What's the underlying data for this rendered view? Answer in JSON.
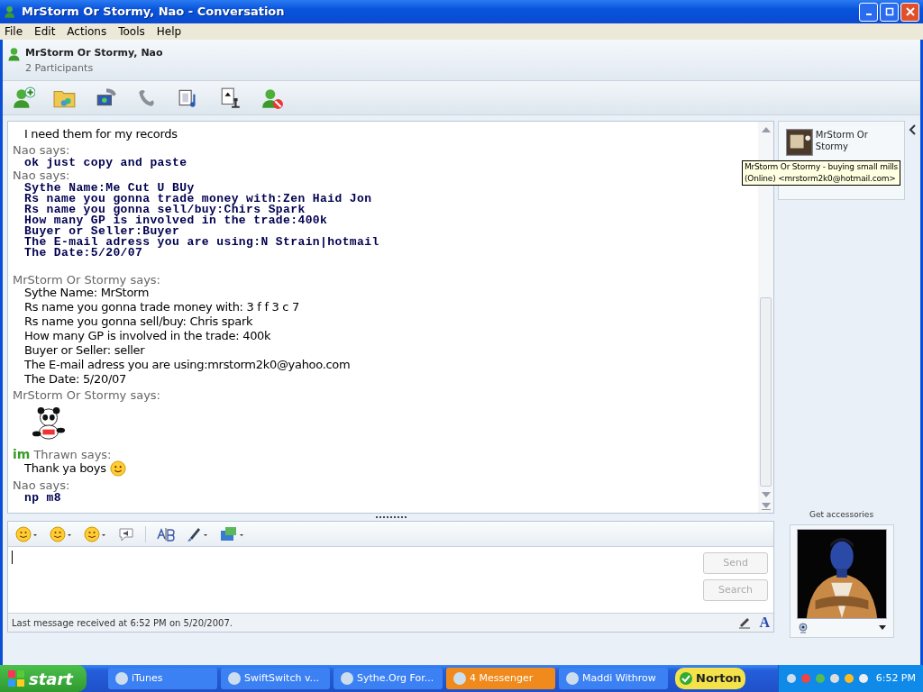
{
  "window": {
    "title": "MrStorm Or Stormy, Nao - Conversation"
  },
  "menu": [
    "File",
    "Edit",
    "Actions",
    "Tools",
    "Help"
  ],
  "header": {
    "title": "MrStorm Or Stormy, Nao",
    "subtitle": "2 Participants"
  },
  "messages": [
    {
      "kind": "plain",
      "text": "I need them for my records"
    },
    {
      "kind": "sender",
      "text": "Nao says:",
      "icon": false
    },
    {
      "kind": "mono",
      "text": "ok just copy and paste"
    },
    {
      "kind": "sender",
      "text": "Nao says:",
      "icon": false
    },
    {
      "kind": "mono",
      "text": "Sythe Name:Me Cut U BUy"
    },
    {
      "kind": "mono",
      "text": "Rs name you gonna trade money with:Zen Haid Jon"
    },
    {
      "kind": "mono",
      "text": "Rs name you gonna sell/buy:Chirs Spark"
    },
    {
      "kind": "mono",
      "text": "How many GP is involved in the trade:400k"
    },
    {
      "kind": "mono",
      "text": "Buyer or Seller:Buyer"
    },
    {
      "kind": "mono",
      "text": "The E-mail adress you are using:N Strain|hotmail"
    },
    {
      "kind": "mono",
      "text": "The Date:5/20/07"
    },
    {
      "kind": "gap"
    },
    {
      "kind": "sender",
      "text": "MrStorm Or Stormy says:",
      "icon": false
    },
    {
      "kind": "plain",
      "text": "Sythe Name: MrStorm"
    },
    {
      "kind": "plain",
      "text": "Rs name you gonna trade money with: 3 f f 3 c 7"
    },
    {
      "kind": "plain",
      "text": "Rs name you gonna sell/buy: Chris spark"
    },
    {
      "kind": "plain",
      "text": "How many GP is involved in the trade: 400k"
    },
    {
      "kind": "plain",
      "text": "Buyer or Seller: seller"
    },
    {
      "kind": "plain",
      "text": "The E-mail adress you are using:mrstorm2k0@yahoo.com"
    },
    {
      "kind": "plain",
      "text": "The Date: 5/20/07"
    },
    {
      "kind": "sender",
      "text": "MrStorm Or Stormy says:",
      "icon": false
    },
    {
      "kind": "emoticon"
    },
    {
      "kind": "sender",
      "text": "Thrawn says:",
      "icon": true,
      "icon_text": "im"
    },
    {
      "kind": "plain",
      "text": "Thank ya boys",
      "smiley": true
    },
    {
      "kind": "sender",
      "text": "Nao says:",
      "icon": false
    },
    {
      "kind": "mono",
      "text": "np m8"
    }
  ],
  "contact": {
    "name": "MrStorm Or Stormy",
    "tooltip_line_1": "MrStorm Or Stormy - buying small mills",
    "tooltip_line_2": "(Online) <mrstorm2k0@hotmail.com>"
  },
  "accessories": "Get accessories",
  "buttons": [
    {
      "label": "Send",
      "disabled": true
    },
    {
      "label": "Search",
      "disabled": true
    }
  ],
  "status": "Last message received at 6:52 PM on 5/20/2007.",
  "text_mode_label": "A",
  "taskbar": {
    "start": "start",
    "items": [
      {
        "label": "iTunes",
        "selected": false
      },
      {
        "label": "SwiftSwitch v...",
        "selected": false
      },
      {
        "label": "Sythe.Org For...",
        "selected": false
      },
      {
        "label": "4 Messenger",
        "selected": true
      },
      {
        "label": "Maddi Withrow",
        "selected": false
      }
    ],
    "norton": "Norton",
    "clock": "6:52 PM"
  }
}
